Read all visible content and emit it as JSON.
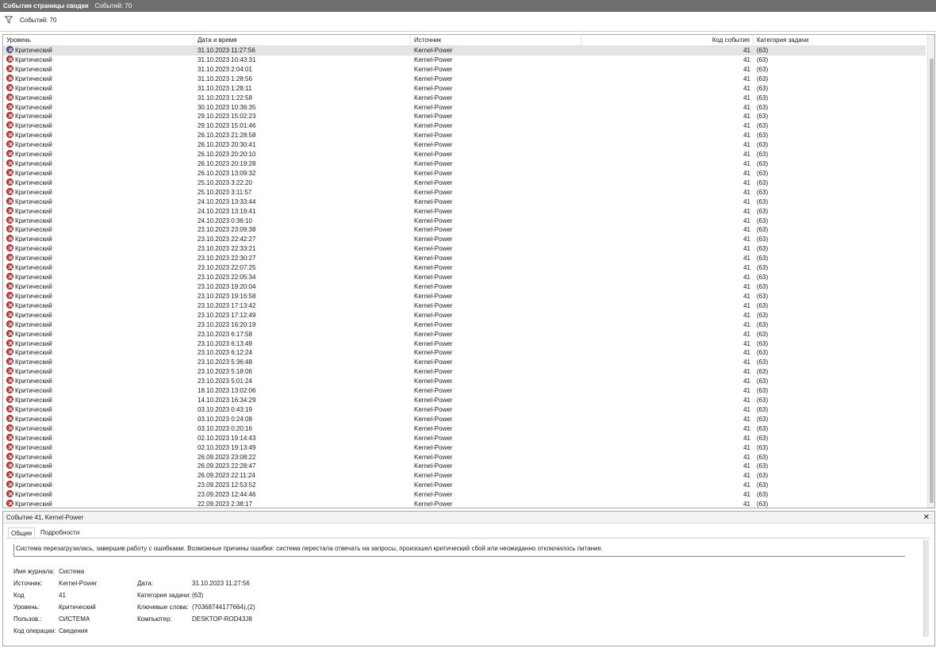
{
  "titlebar": {
    "title": "События страницы сводки",
    "count": "Событий: 70"
  },
  "filterbar": {
    "icon": "filter-icon",
    "count": "Событий: 70"
  },
  "columns": {
    "level": "Уровень",
    "datetime": "Дата и время",
    "source": "Источник",
    "event_id": "Код события",
    "task_category": "Категория задачи"
  },
  "rows": [
    {
      "level": "Критический",
      "datetime": "31.10.2023 11:27:56",
      "source": "Kernel-Power",
      "event_id": "41",
      "category": "(63)",
      "selected": true
    },
    {
      "level": "Критический",
      "datetime": "31.10.2023 10:43:31",
      "source": "Kernel-Power",
      "event_id": "41",
      "category": "(63)"
    },
    {
      "level": "Критический",
      "datetime": "31.10.2023 2:04:01",
      "source": "Kernel-Power",
      "event_id": "41",
      "category": "(63)"
    },
    {
      "level": "Критический",
      "datetime": "31.10.2023 1:28:56",
      "source": "Kernel-Power",
      "event_id": "41",
      "category": "(63)"
    },
    {
      "level": "Критический",
      "datetime": "31.10.2023 1:28:11",
      "source": "Kernel-Power",
      "event_id": "41",
      "category": "(63)"
    },
    {
      "level": "Критический",
      "datetime": "31.10.2023 1:22:58",
      "source": "Kernel-Power",
      "event_id": "41",
      "category": "(63)"
    },
    {
      "level": "Критический",
      "datetime": "30.10.2023 10:36:35",
      "source": "Kernel-Power",
      "event_id": "41",
      "category": "(63)"
    },
    {
      "level": "Критический",
      "datetime": "29.10.2023 15:02:23",
      "source": "Kernel-Power",
      "event_id": "41",
      "category": "(63)"
    },
    {
      "level": "Критический",
      "datetime": "29.10.2023 15:01:46",
      "source": "Kernel-Power",
      "event_id": "41",
      "category": "(63)"
    },
    {
      "level": "Критический",
      "datetime": "26.10.2023 21:28:58",
      "source": "Kernel-Power",
      "event_id": "41",
      "category": "(63)"
    },
    {
      "level": "Критический",
      "datetime": "26.10.2023 20:30:41",
      "source": "Kernel-Power",
      "event_id": "41",
      "category": "(63)"
    },
    {
      "level": "Критический",
      "datetime": "26.10.2023 20:20:10",
      "source": "Kernel-Power",
      "event_id": "41",
      "category": "(63)"
    },
    {
      "level": "Критический",
      "datetime": "26.10.2023 20:19:28",
      "source": "Kernel-Power",
      "event_id": "41",
      "category": "(63)"
    },
    {
      "level": "Критический",
      "datetime": "26.10.2023 13:09:32",
      "source": "Kernel-Power",
      "event_id": "41",
      "category": "(63)"
    },
    {
      "level": "Критический",
      "datetime": "25.10.2023 3:22:20",
      "source": "Kernel-Power",
      "event_id": "41",
      "category": "(63)"
    },
    {
      "level": "Критический",
      "datetime": "25.10.2023 3:11:57",
      "source": "Kernel-Power",
      "event_id": "41",
      "category": "(63)"
    },
    {
      "level": "Критический",
      "datetime": "24.10.2023 13:33:44",
      "source": "Kernel-Power",
      "event_id": "41",
      "category": "(63)"
    },
    {
      "level": "Критический",
      "datetime": "24.10.2023 13:19:41",
      "source": "Kernel-Power",
      "event_id": "41",
      "category": "(63)"
    },
    {
      "level": "Критический",
      "datetime": "24.10.2023 0:36:10",
      "source": "Kernel-Power",
      "event_id": "41",
      "category": "(63)"
    },
    {
      "level": "Критический",
      "datetime": "23.10.2023 23:09:38",
      "source": "Kernel-Power",
      "event_id": "41",
      "category": "(63)"
    },
    {
      "level": "Критический",
      "datetime": "23.10.2023 22:42:27",
      "source": "Kernel-Power",
      "event_id": "41",
      "category": "(63)"
    },
    {
      "level": "Критический",
      "datetime": "23.10.2023 22:33:21",
      "source": "Kernel-Power",
      "event_id": "41",
      "category": "(63)"
    },
    {
      "level": "Критический",
      "datetime": "23.10.2023 22:30:27",
      "source": "Kernel-Power",
      "event_id": "41",
      "category": "(63)"
    },
    {
      "level": "Критический",
      "datetime": "23.10.2023 22:07:25",
      "source": "Kernel-Power",
      "event_id": "41",
      "category": "(63)"
    },
    {
      "level": "Критический",
      "datetime": "23.10.2023 22:05:34",
      "source": "Kernel-Power",
      "event_id": "41",
      "category": "(63)"
    },
    {
      "level": "Критический",
      "datetime": "23.10.2023 19:20:04",
      "source": "Kernel-Power",
      "event_id": "41",
      "category": "(63)"
    },
    {
      "level": "Критический",
      "datetime": "23.10.2023 19:16:58",
      "source": "Kernel-Power",
      "event_id": "41",
      "category": "(63)"
    },
    {
      "level": "Критический",
      "datetime": "23.10.2023 17:13:42",
      "source": "Kernel-Power",
      "event_id": "41",
      "category": "(63)"
    },
    {
      "level": "Критический",
      "datetime": "23.10.2023 17:12:49",
      "source": "Kernel-Power",
      "event_id": "41",
      "category": "(63)"
    },
    {
      "level": "Критический",
      "datetime": "23.10.2023 16:20:19",
      "source": "Kernel-Power",
      "event_id": "41",
      "category": "(63)"
    },
    {
      "level": "Критический",
      "datetime": "23.10.2023 6:17:58",
      "source": "Kernel-Power",
      "event_id": "41",
      "category": "(63)"
    },
    {
      "level": "Критический",
      "datetime": "23.10.2023 6:13:49",
      "source": "Kernel-Power",
      "event_id": "41",
      "category": "(63)"
    },
    {
      "level": "Критический",
      "datetime": "23.10.2023 6:12:24",
      "source": "Kernel-Power",
      "event_id": "41",
      "category": "(63)"
    },
    {
      "level": "Критический",
      "datetime": "23.10.2023 5:36:48",
      "source": "Kernel-Power",
      "event_id": "41",
      "category": "(63)"
    },
    {
      "level": "Критический",
      "datetime": "23.10.2023 5:18:06",
      "source": "Kernel-Power",
      "event_id": "41",
      "category": "(63)"
    },
    {
      "level": "Критический",
      "datetime": "23.10.2023 5:01:24",
      "source": "Kernel-Power",
      "event_id": "41",
      "category": "(63)"
    },
    {
      "level": "Критический",
      "datetime": "18.10.2023 13:02:06",
      "source": "Kernel-Power",
      "event_id": "41",
      "category": "(63)"
    },
    {
      "level": "Критический",
      "datetime": "14.10.2023 16:34:29",
      "source": "Kernel-Power",
      "event_id": "41",
      "category": "(63)"
    },
    {
      "level": "Критический",
      "datetime": "03.10.2023 0:43:19",
      "source": "Kernel-Power",
      "event_id": "41",
      "category": "(63)"
    },
    {
      "level": "Критический",
      "datetime": "03.10.2023 0:24:08",
      "source": "Kernel-Power",
      "event_id": "41",
      "category": "(63)"
    },
    {
      "level": "Критический",
      "datetime": "03.10.2023 0:20:16",
      "source": "Kernel-Power",
      "event_id": "41",
      "category": "(63)"
    },
    {
      "level": "Критический",
      "datetime": "02.10.2023 19:14:43",
      "source": "Kernel-Power",
      "event_id": "41",
      "category": "(63)"
    },
    {
      "level": "Критический",
      "datetime": "02.10.2023 19:13:49",
      "source": "Kernel-Power",
      "event_id": "41",
      "category": "(63)"
    },
    {
      "level": "Критический",
      "datetime": "26.09.2023 23:08:22",
      "source": "Kernel-Power",
      "event_id": "41",
      "category": "(63)"
    },
    {
      "level": "Критический",
      "datetime": "26.09.2023 22:28:47",
      "source": "Kernel-Power",
      "event_id": "41",
      "category": "(63)"
    },
    {
      "level": "Критический",
      "datetime": "26.09.2023 22:11:24",
      "source": "Kernel-Power",
      "event_id": "41",
      "category": "(63)"
    },
    {
      "level": "Критический",
      "datetime": "23.09.2023 12:53:52",
      "source": "Kernel-Power",
      "event_id": "41",
      "category": "(63)"
    },
    {
      "level": "Критический",
      "datetime": "23.09.2023 12:44:46",
      "source": "Kernel-Power",
      "event_id": "41",
      "category": "(63)"
    },
    {
      "level": "Критический",
      "datetime": "22.09.2023 2:38:17",
      "source": "Kernel-Power",
      "event_id": "41",
      "category": "(63)"
    }
  ],
  "detail": {
    "title": "Событие 41, Kernel-Power",
    "close_icon": "close-icon",
    "tabs": {
      "general": "Общие",
      "details": "Подробности"
    },
    "description": "Система перезагрузилась, завершив работу с ошибками. Возможные причины ошибки: система перестала отвечать на запросы, произошел критический сбой или неожиданно отключилось питание.",
    "props": {
      "log_name_label": "Имя журнала:",
      "log_name": "Система",
      "source_label": "Источник:",
      "source": "Kernel-Power",
      "date_label": "Дата:",
      "date": "31.10.2023 11:27:56",
      "code_label": "Код",
      "code": "41",
      "task_cat_label": "Категория задачи:",
      "task_cat": "(63)",
      "level_label": "Уровень:",
      "level": "Критический",
      "keywords_label": "Ключевые слова:",
      "keywords": "(70368744177664),(2)",
      "user_label": "Пользов.:",
      "user": "СИСТЕМА",
      "computer_label": "Компьютер:",
      "computer": "DESKTOP-ROD43J8",
      "opcode_label": "Код операции:",
      "opcode": "Сведения"
    }
  },
  "colors": {
    "titlebar_bg": "#6e6e6e",
    "critical_icon": "#c74545",
    "selected_row": "#e4e4e4"
  }
}
